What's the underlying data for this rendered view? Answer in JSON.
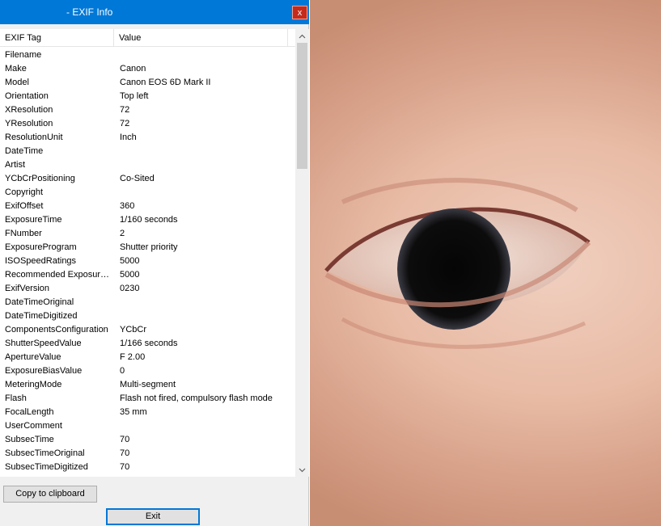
{
  "window": {
    "title": "- EXIF Info",
    "close_label": "x"
  },
  "listview": {
    "col_tag": "EXIF Tag",
    "col_value": "Value",
    "rows": [
      {
        "tag": "Filename",
        "value": ""
      },
      {
        "tag": "Make",
        "value": "Canon"
      },
      {
        "tag": "Model",
        "value": "Canon EOS 6D Mark II"
      },
      {
        "tag": "Orientation",
        "value": "Top left"
      },
      {
        "tag": "XResolution",
        "value": "72"
      },
      {
        "tag": "YResolution",
        "value": "72"
      },
      {
        "tag": "ResolutionUnit",
        "value": "Inch"
      },
      {
        "tag": "DateTime",
        "value": ""
      },
      {
        "tag": "Artist",
        "value": ""
      },
      {
        "tag": "YCbCrPositioning",
        "value": "Co-Sited"
      },
      {
        "tag": "Copyright",
        "value": ""
      },
      {
        "tag": "ExifOffset",
        "value": "360"
      },
      {
        "tag": "ExposureTime",
        "value": "1/160 seconds"
      },
      {
        "tag": "FNumber",
        "value": "2"
      },
      {
        "tag": "ExposureProgram",
        "value": "Shutter priority"
      },
      {
        "tag": "ISOSpeedRatings",
        "value": "5000"
      },
      {
        "tag": "Recommended Exposure I...",
        "value": "5000"
      },
      {
        "tag": "ExifVersion",
        "value": "0230"
      },
      {
        "tag": "DateTimeOriginal",
        "value": ""
      },
      {
        "tag": "DateTimeDigitized",
        "value": ""
      },
      {
        "tag": "ComponentsConfiguration",
        "value": "YCbCr"
      },
      {
        "tag": "ShutterSpeedValue",
        "value": "1/166 seconds"
      },
      {
        "tag": "ApertureValue",
        "value": "F 2.00"
      },
      {
        "tag": "ExposureBiasValue",
        "value": "0"
      },
      {
        "tag": "MeteringMode",
        "value": "Multi-segment"
      },
      {
        "tag": "Flash",
        "value": "Flash not fired, compulsory flash mode"
      },
      {
        "tag": "FocalLength",
        "value": "35 mm"
      },
      {
        "tag": "UserComment",
        "value": ""
      },
      {
        "tag": "SubsecTime",
        "value": "70"
      },
      {
        "tag": "SubsecTimeOriginal",
        "value": "70"
      },
      {
        "tag": "SubsecTimeDigitized",
        "value": "70"
      }
    ]
  },
  "buttons": {
    "copy_label": "Copy to clipboard",
    "exit_label": "Exit"
  },
  "icons": {
    "scroll_up": "chevron-up-icon",
    "scroll_down": "chevron-down-icon"
  }
}
